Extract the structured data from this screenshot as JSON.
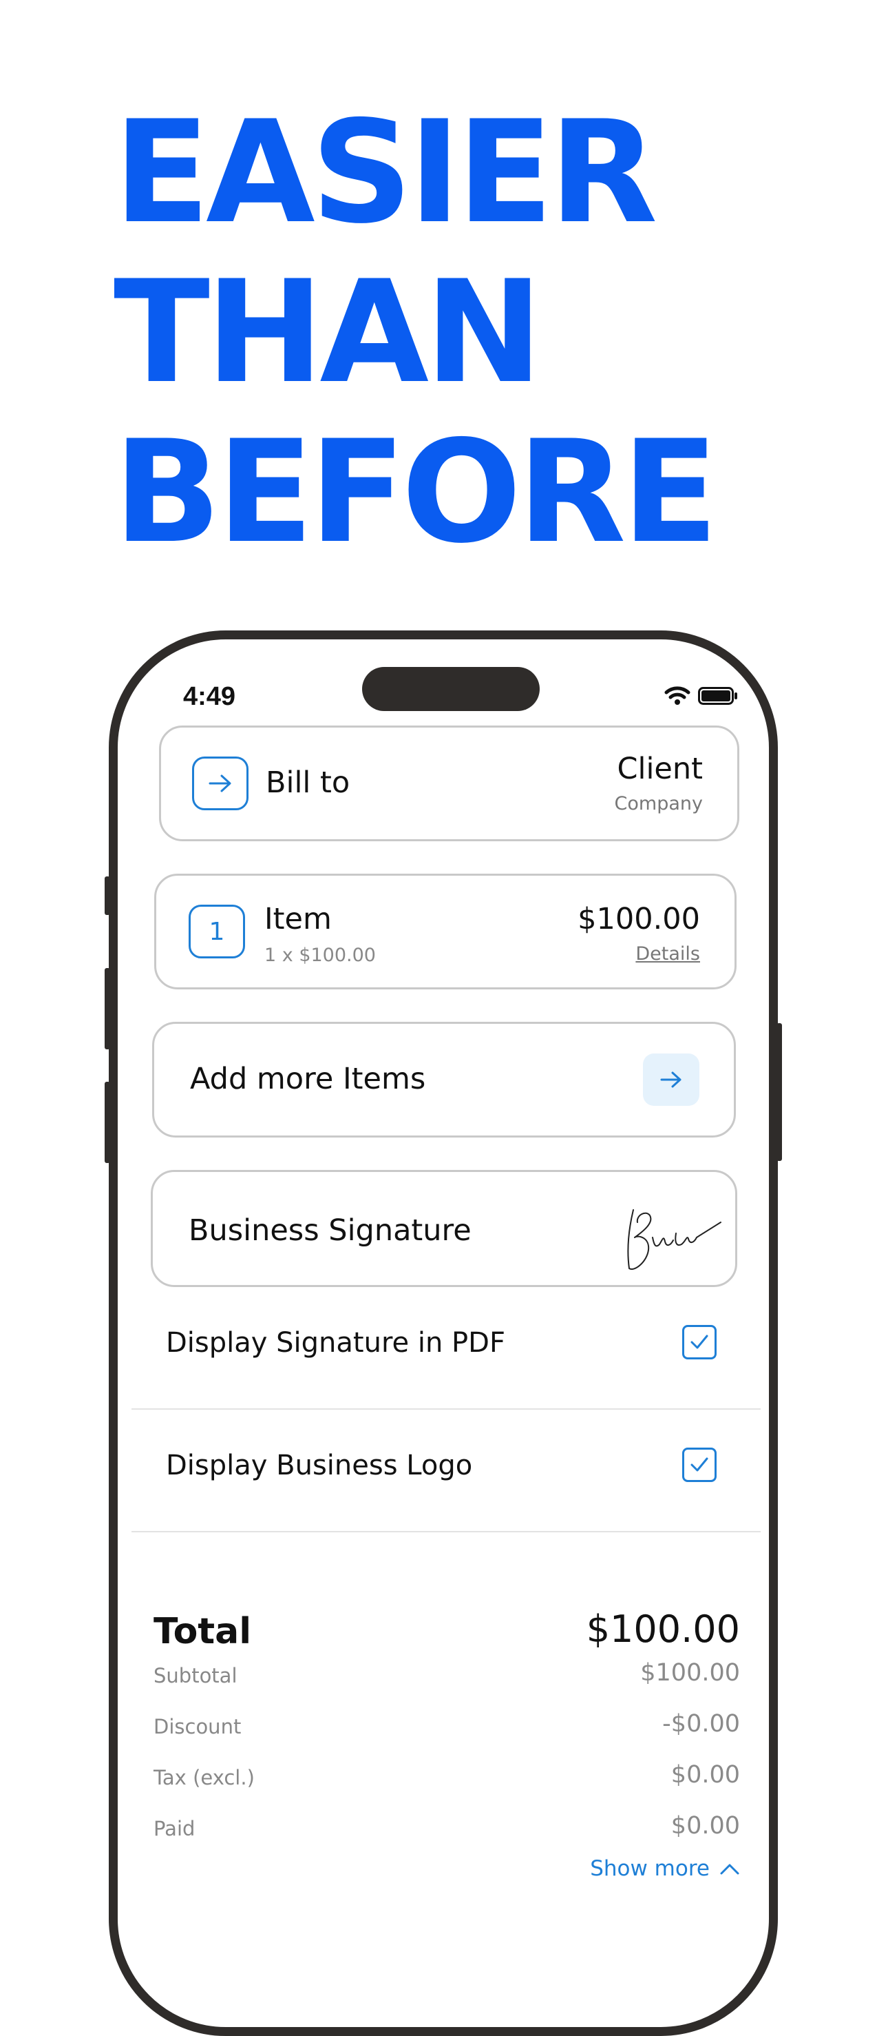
{
  "headline": {
    "line1": "EASIER",
    "line2": "THAN",
    "line3": "BEFORE"
  },
  "status_bar": {
    "time": "4:49"
  },
  "bill_to": {
    "label": "Bill to",
    "client": "Client",
    "company": "Company"
  },
  "item": {
    "quantity_badge": "1",
    "name": "Item",
    "detail": "1 x $100.00",
    "price": "$100.00",
    "details_link": "Details"
  },
  "add_items": {
    "label": "Add more Items"
  },
  "signature": {
    "label": "Business Signature"
  },
  "toggles": [
    {
      "label": "Display Signature in PDF",
      "checked": true
    },
    {
      "label": "Display Business Logo",
      "checked": true
    }
  ],
  "totals": {
    "total_label": "Total",
    "total_value": "$100.00",
    "rows": [
      {
        "label": "Subtotal",
        "value": "$100.00"
      },
      {
        "label": "Discount",
        "value": "-$0.00"
      },
      {
        "label": "Tax (excl.)",
        "value": "$0.00"
      },
      {
        "label": "Paid",
        "value": "$0.00"
      }
    ],
    "show_more": "Show more"
  },
  "colors": {
    "brand_blue": "#0a5cf0",
    "accent_blue": "#1e7fd6",
    "frame": "#2f2c2a"
  }
}
